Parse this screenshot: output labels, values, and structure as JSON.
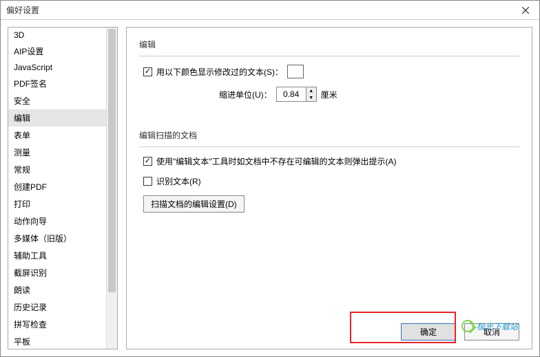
{
  "window": {
    "title": "偏好设置"
  },
  "sidebar": {
    "items": [
      {
        "label": "3D"
      },
      {
        "label": "AIP设置"
      },
      {
        "label": "JavaScript"
      },
      {
        "label": "PDF签名"
      },
      {
        "label": "安全"
      },
      {
        "label": "编辑",
        "selected": true
      },
      {
        "label": "表单"
      },
      {
        "label": "测量"
      },
      {
        "label": "常规"
      },
      {
        "label": "创建PDF"
      },
      {
        "label": "打印"
      },
      {
        "label": "动作向导"
      },
      {
        "label": "多媒体（旧版）"
      },
      {
        "label": "辅助工具"
      },
      {
        "label": "截屏识别"
      },
      {
        "label": "朗读"
      },
      {
        "label": "历史记录"
      },
      {
        "label": "拼写检查"
      },
      {
        "label": "平板"
      }
    ]
  },
  "panel": {
    "group1": {
      "title": "编辑",
      "show_edited_color_label": "用以下颜色显示修改过的文本(S)：",
      "show_edited_color_checked": true,
      "color": "#2ee82e",
      "indent_unit_label": "缩进单位(U)：",
      "indent_value": "0.84",
      "indent_unit_suffix": "厘米"
    },
    "group2": {
      "title": "编辑扫描的文档",
      "prompt_label": "使用\"编辑文本\"工具时如文档中不存在可编辑的文本则弹出提示(A)",
      "prompt_checked": true,
      "ocr_label": "识别文本(R)",
      "ocr_checked": false,
      "settings_button": "扫描文档的编辑设置(D)"
    }
  },
  "footer": {
    "ok": "确定",
    "cancel": "取消"
  },
  "watermark": "极光下载站"
}
